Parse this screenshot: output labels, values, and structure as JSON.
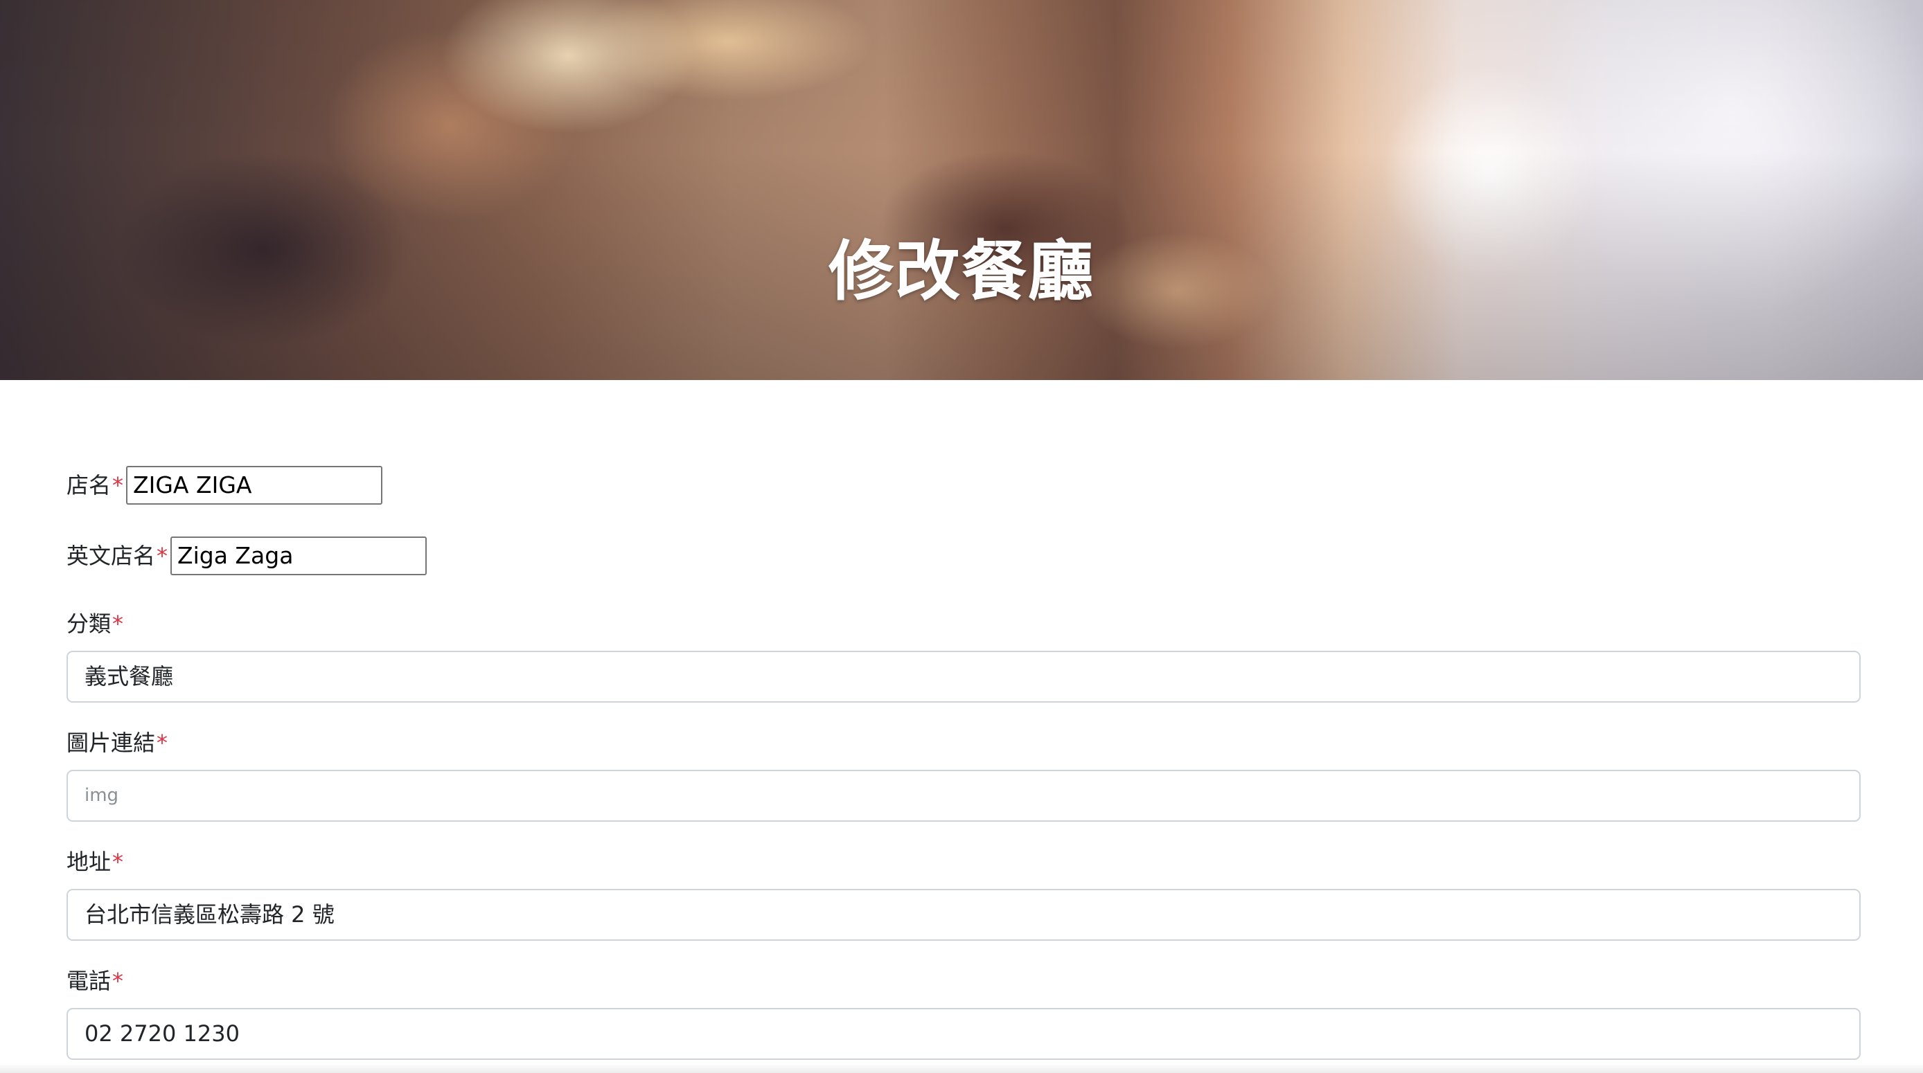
{
  "banner": {
    "title": "修改餐廳"
  },
  "form": {
    "required_mark": "*",
    "name": {
      "label": "店名",
      "value": "ZIGA ZIGA"
    },
    "name_en": {
      "label": "英文店名",
      "value": "Ziga Zaga"
    },
    "category": {
      "label": "分類",
      "value": "義式餐廳"
    },
    "image": {
      "label": "圖片連結",
      "value": "",
      "placeholder": "img"
    },
    "location": {
      "label": "地址",
      "value": "台北市信義區松壽路 2 號"
    },
    "phone": {
      "label": "電話",
      "value": "02 2720 1230"
    }
  },
  "colors": {
    "required": "#dc3545",
    "input_border": "#ced4da"
  }
}
